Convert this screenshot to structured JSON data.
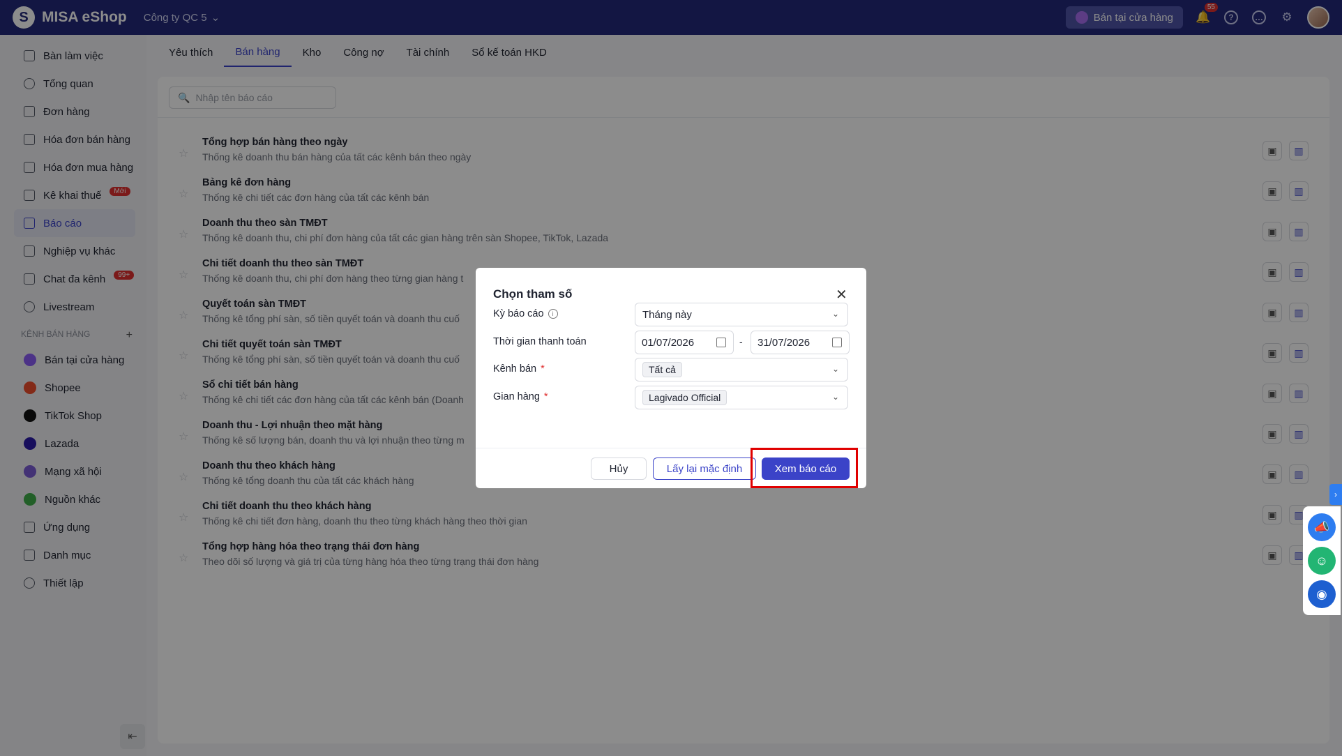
{
  "topbar": {
    "brand": "MISA eShop",
    "company": "Công ty QC 5",
    "store_button": "Bán tại cửa hàng",
    "notification_count": "55"
  },
  "sidebar": {
    "items": [
      {
        "label": "Bàn làm việc"
      },
      {
        "label": "Tổng quan"
      },
      {
        "label": "Đơn hàng"
      },
      {
        "label": "Hóa đơn bán hàng"
      },
      {
        "label": "Hóa đơn mua hàng"
      },
      {
        "label": "Kê khai thuế",
        "badge": "Mới"
      },
      {
        "label": "Báo cáo"
      },
      {
        "label": "Nghiệp vụ khác"
      },
      {
        "label": "Chat đa kênh",
        "badge": "99+"
      },
      {
        "label": "Livestream"
      }
    ],
    "section_title": "KÊNH BÁN HÀNG",
    "channels": [
      {
        "label": "Bán tại cửa hàng",
        "color": "#8b5cf6"
      },
      {
        "label": "Shopee",
        "color": "#ee4d2d"
      },
      {
        "label": "TikTok Shop",
        "color": "#111111"
      },
      {
        "label": "Lazada",
        "color": "#2b1aa8"
      },
      {
        "label": "Mạng xã hội",
        "color": "#7b5bd6"
      },
      {
        "label": "Nguồn khác",
        "color": "#3fae49"
      }
    ],
    "bottom_items": [
      {
        "label": "Ứng dụng"
      },
      {
        "label": "Danh mục"
      },
      {
        "label": "Thiết lập"
      }
    ]
  },
  "tabs": [
    "Yêu thích",
    "Bán hàng",
    "Kho",
    "Công nợ",
    "Tài chính",
    "Sổ kế toán HKD"
  ],
  "search": {
    "placeholder": "Nhập tên báo cáo"
  },
  "reports": [
    {
      "title": "Tổng hợp bán hàng theo ngày",
      "desc": "Thống kê doanh thu bán hàng của tất các kênh bán theo ngày"
    },
    {
      "title": "Bảng kê đơn hàng",
      "desc": "Thống kê chi tiết các đơn hàng của tất các kênh bán"
    },
    {
      "title": "Doanh thu theo sàn TMĐT",
      "desc": "Thống kê doanh thu, chi phí đơn hàng của tất các gian hàng trên sàn Shopee, TikTok, Lazada"
    },
    {
      "title": "Chi tiết doanh thu theo sàn TMĐT",
      "desc": "Thống kê doanh thu, chi phí đơn hàng theo từng gian hàng t"
    },
    {
      "title": "Quyết toán sàn TMĐT",
      "desc": "Thống kê tổng phí sàn, số tiền quyết toán và doanh thu cuố"
    },
    {
      "title": "Chi tiết quyết toán sàn TMĐT",
      "desc": "Thống kê tổng phí sàn, số tiền quyết toán và doanh thu cuố"
    },
    {
      "title": "Sổ chi tiết bán hàng",
      "desc": "Thống kê chi tiết các đơn hàng của tất các kênh bán (Doanh"
    },
    {
      "title": "Doanh thu - Lợi nhuận theo mặt hàng",
      "desc": "Thống kê số lượng bán, doanh thu và lợi nhuận theo từng m"
    },
    {
      "title": "Doanh thu theo khách hàng",
      "desc": "Thống kê tổng doanh thu của tất các khách hàng"
    },
    {
      "title": "Chi tiết doanh thu theo khách hàng",
      "desc": "Thống kê chi tiết đơn hàng, doanh thu theo từng khách hàng theo thời gian"
    },
    {
      "title": "Tổng hợp hàng hóa theo trạng thái đơn hàng",
      "desc": "Theo dõi số lượng và giá trị của từng hàng hóa theo từng trạng thái đơn hàng"
    }
  ],
  "modal": {
    "title": "Chọn tham số",
    "period_label": "Kỳ báo cáo",
    "period_value": "Tháng này",
    "payment_time_label": "Thời gian thanh toán",
    "date_from": "01/07/2026",
    "date_sep": "-",
    "date_to": "31/07/2026",
    "channel_label": "Kênh bán",
    "channel_value": "Tất cả",
    "store_label": "Gian hàng",
    "store_value": "Lagivado Official",
    "required_mark": "*",
    "cancel": "Hủy",
    "reset": "Lấy lại mặc định",
    "view": "Xem báo cáo"
  },
  "colors": {
    "topbar": "#23297a",
    "accent": "#3b43c8",
    "highlight": "#e00000"
  }
}
